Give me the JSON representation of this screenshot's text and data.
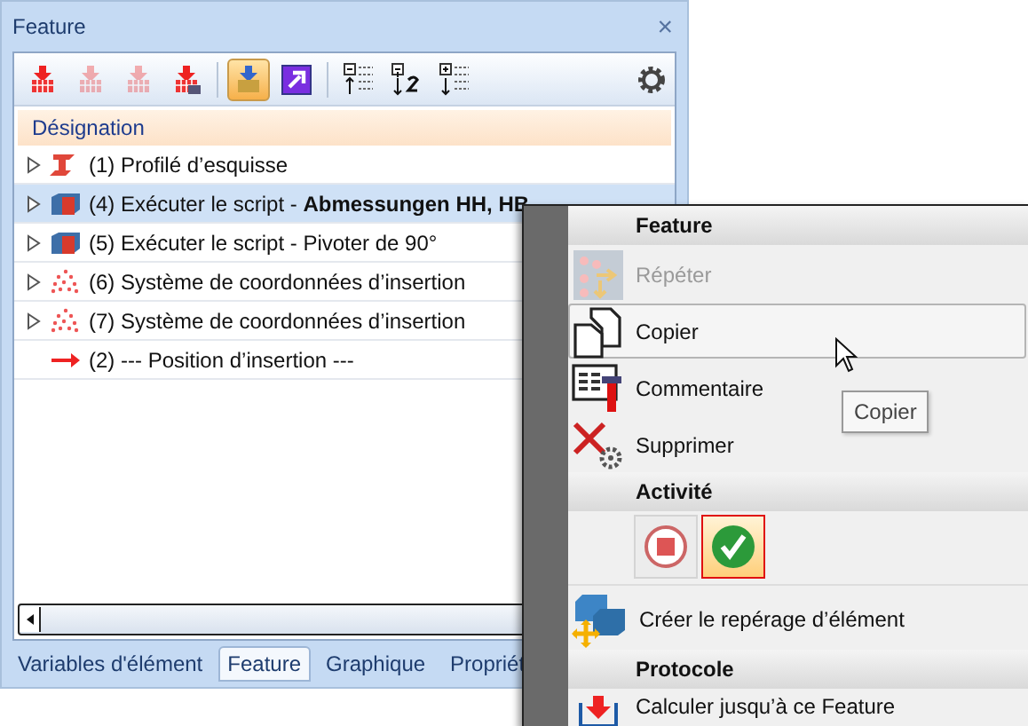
{
  "panel": {
    "title": "Feature",
    "close": "×"
  },
  "toolbar": [
    {
      "kind": "calc",
      "disabled": false,
      "selected": false
    },
    {
      "kind": "calc",
      "disabled": true,
      "selected": false
    },
    {
      "kind": "calc",
      "disabled": true,
      "selected": false
    },
    {
      "kind": "part",
      "disabled": false,
      "selected": false
    },
    {
      "kind": "auto",
      "disabled": false,
      "selected": true
    },
    {
      "kind": "jump",
      "disabled": false,
      "selected": false
    },
    {
      "kind": "collapse",
      "disabled": false,
      "selected": false
    },
    {
      "kind": "level",
      "disabled": false,
      "selected": false
    },
    {
      "kind": "expand",
      "disabled": false,
      "selected": false
    }
  ],
  "tree": {
    "column": "Désignation",
    "rows": [
      {
        "kind": "profile",
        "text": "(1) Profilé d’esquisse",
        "expandable": true,
        "selected": false
      },
      {
        "kind": "script",
        "text": "(4) Exécuter le script - **Abmessungen HH, HB**",
        "expandable": true,
        "selected": true
      },
      {
        "kind": "script",
        "text": "(5) Exécuter le script - Pivoter de 90°",
        "expandable": true,
        "selected": false
      },
      {
        "kind": "coords",
        "text": "(6) Système de coordonnées d’insertion",
        "expandable": true,
        "selected": false
      },
      {
        "kind": "coords",
        "text": "(7) Système de coordonnées d’insertion",
        "expandable": true,
        "selected": false
      },
      {
        "kind": "position",
        "text": "(2) --- Position  d’insertion ---",
        "expandable": false,
        "selected": false
      }
    ]
  },
  "tabs": [
    {
      "label": "Variables d'élément",
      "selected": false
    },
    {
      "label": "Feature",
      "selected": true
    },
    {
      "label": "Graphique",
      "selected": false
    },
    {
      "label": "Propriét",
      "selected": false
    }
  ],
  "context_menu": {
    "sections": [
      {
        "title": "Feature",
        "items": [
          {
            "kind": "repeat",
            "label": "Répéter",
            "disabled": true,
            "highlighted": false
          },
          {
            "kind": "copy",
            "label": "Copier",
            "disabled": false,
            "highlighted": true
          },
          {
            "kind": "comment",
            "label": "Commentaire",
            "disabled": false,
            "highlighted": false
          },
          {
            "kind": "delete",
            "label": "Supprimer",
            "disabled": false,
            "highlighted": false
          }
        ]
      },
      {
        "title": "Activité",
        "items": [
          {
            "kind": "buttons",
            "buttons": [
              {
                "kind": "stop",
                "selected": false
              },
              {
                "kind": "check",
                "selected": true
              }
            ]
          },
          {
            "kind": "mark",
            "label": "Créer le repérage d’élément",
            "disabled": false,
            "highlighted": false
          }
        ]
      },
      {
        "title": "Protocole",
        "items": [
          {
            "kind": "calc",
            "label": "Calculer jusqu’à ce Feature",
            "disabled": false,
            "highlighted": false
          }
        ]
      }
    ]
  },
  "tooltip": "Copier"
}
